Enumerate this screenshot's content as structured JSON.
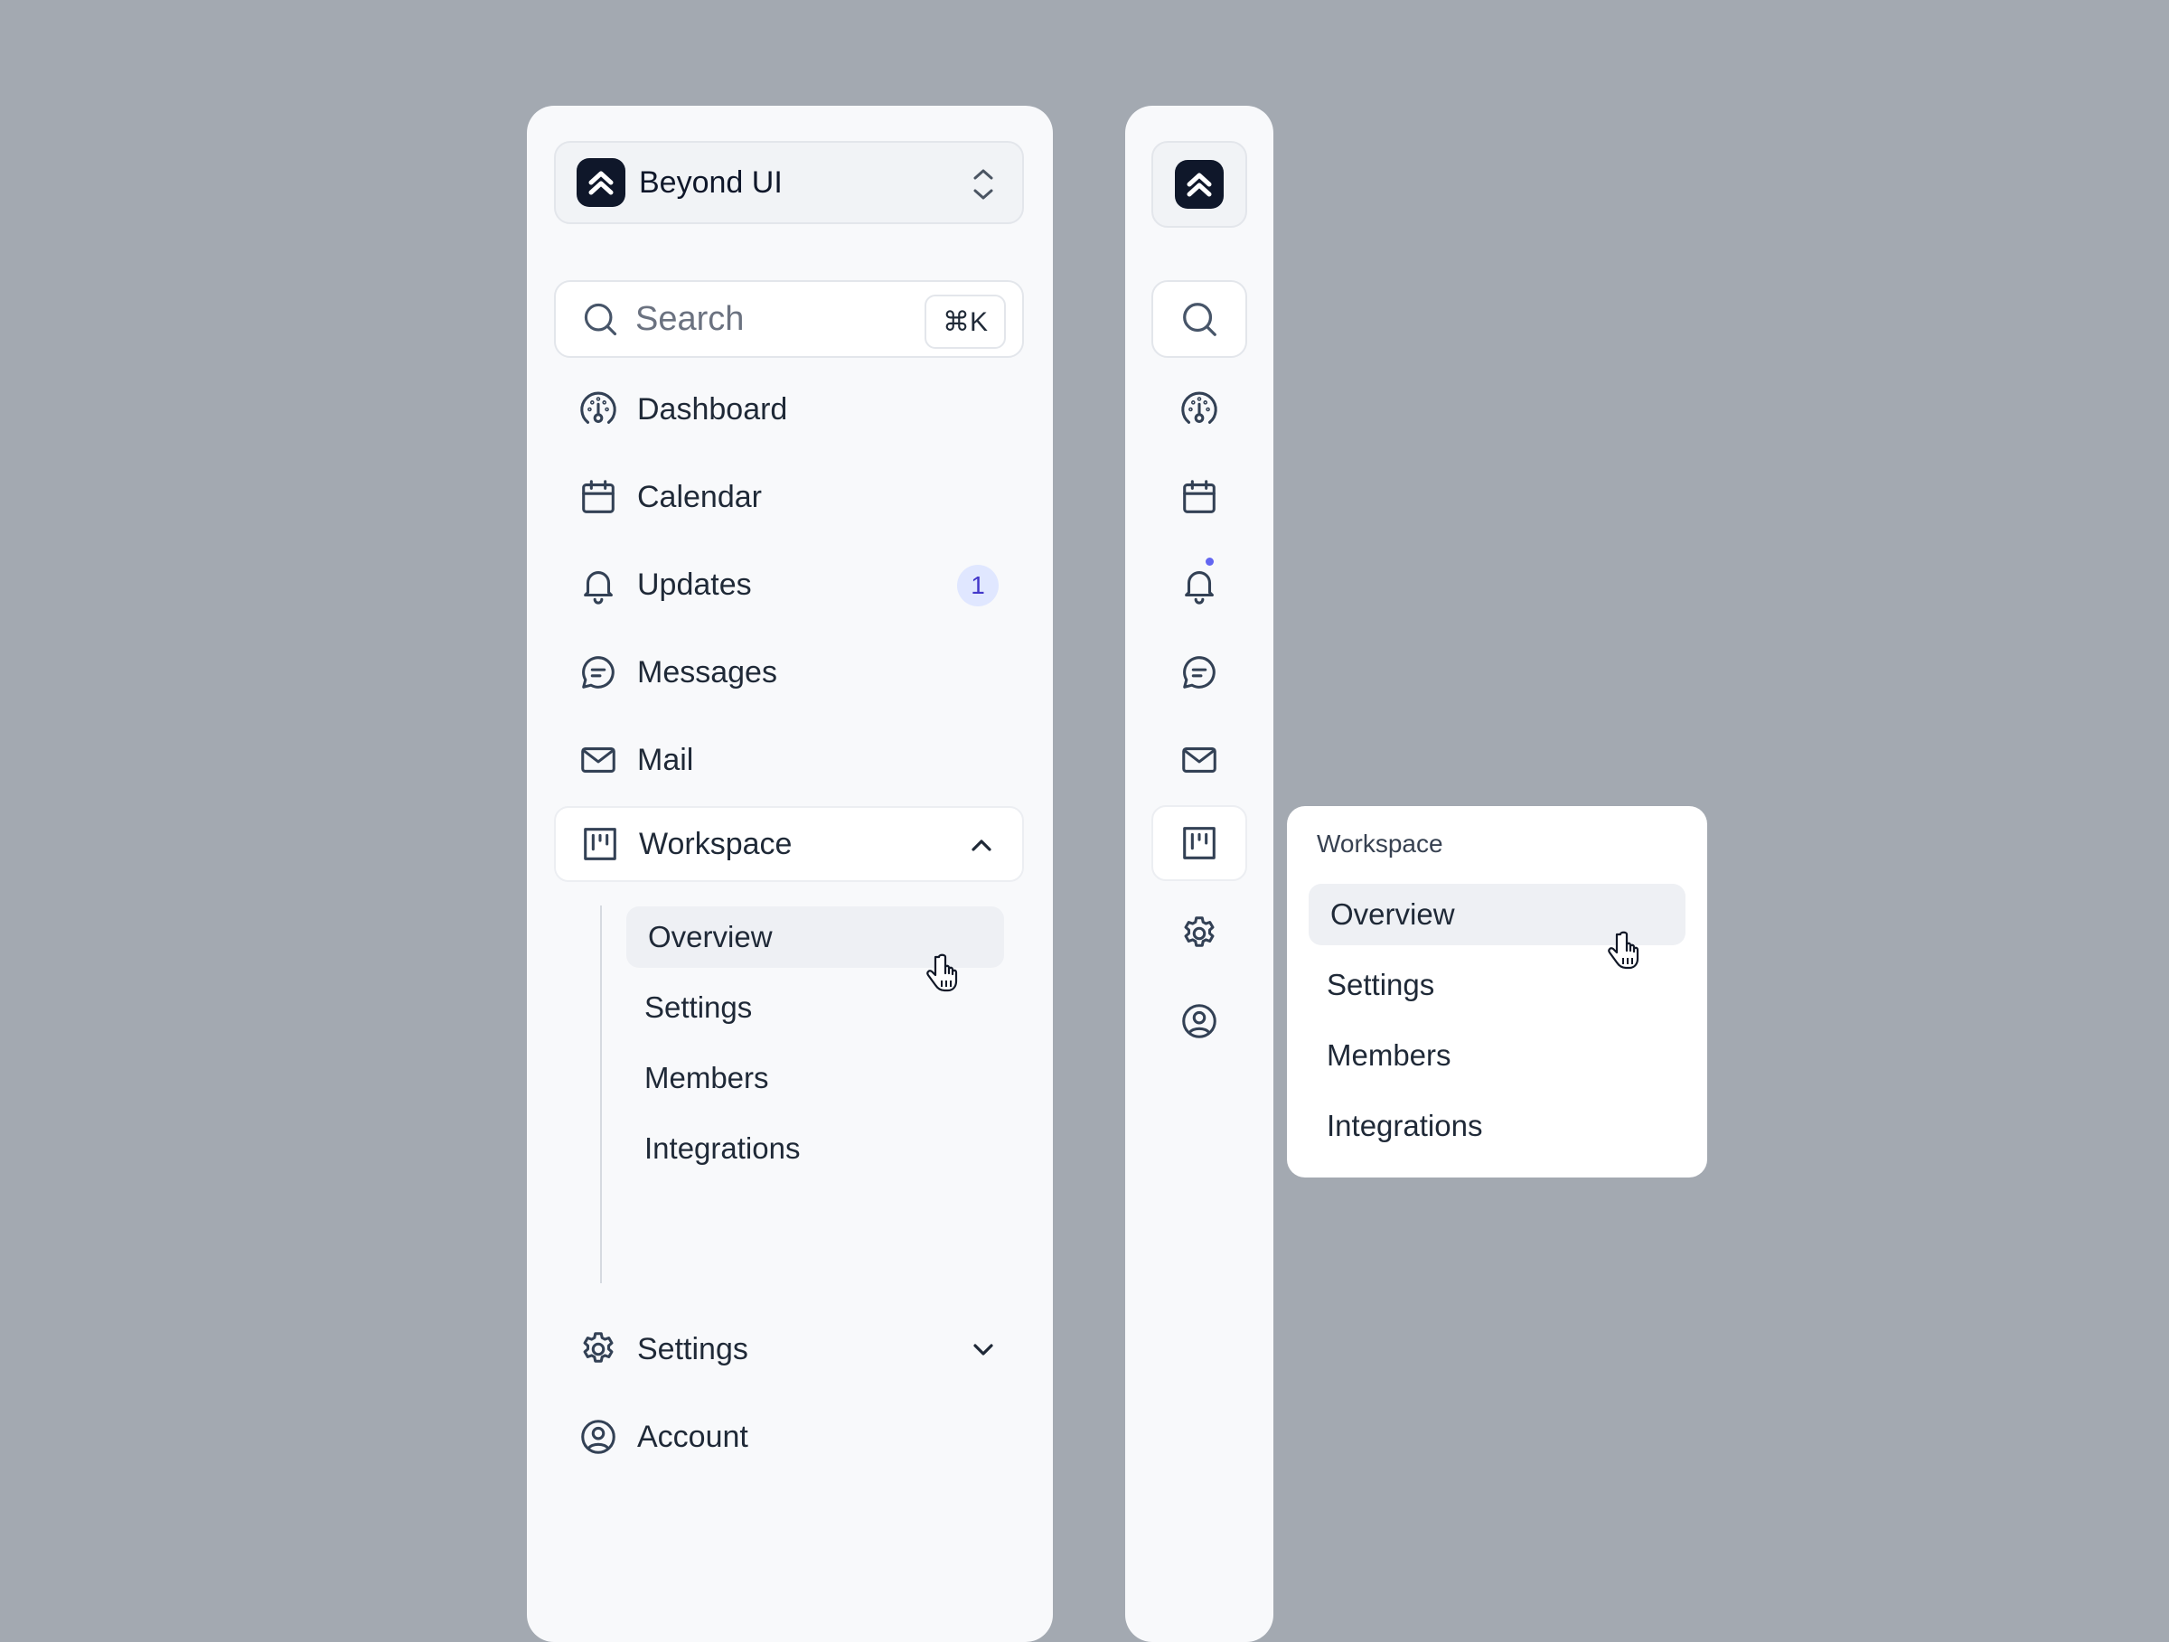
{
  "team": {
    "name": "Beyond UI"
  },
  "search": {
    "placeholder": "Search",
    "shortcut": "⌘K"
  },
  "nav": {
    "dashboard": "Dashboard",
    "calendar": "Calendar",
    "updates": "Updates",
    "updates_badge": "1",
    "messages": "Messages",
    "mail": "Mail",
    "workspace": "Workspace",
    "settings": "Settings",
    "account": "Account"
  },
  "workspace_submenu": [
    "Overview",
    "Settings",
    "Members",
    "Integrations"
  ],
  "flyout": {
    "title": "Workspace"
  },
  "colors": {
    "background": "#a3a9b1",
    "sidebar": "#f8f9fb",
    "badge_bg": "#e0e7ff",
    "badge_text": "#4338ca",
    "notification_dot": "#6366f1"
  }
}
